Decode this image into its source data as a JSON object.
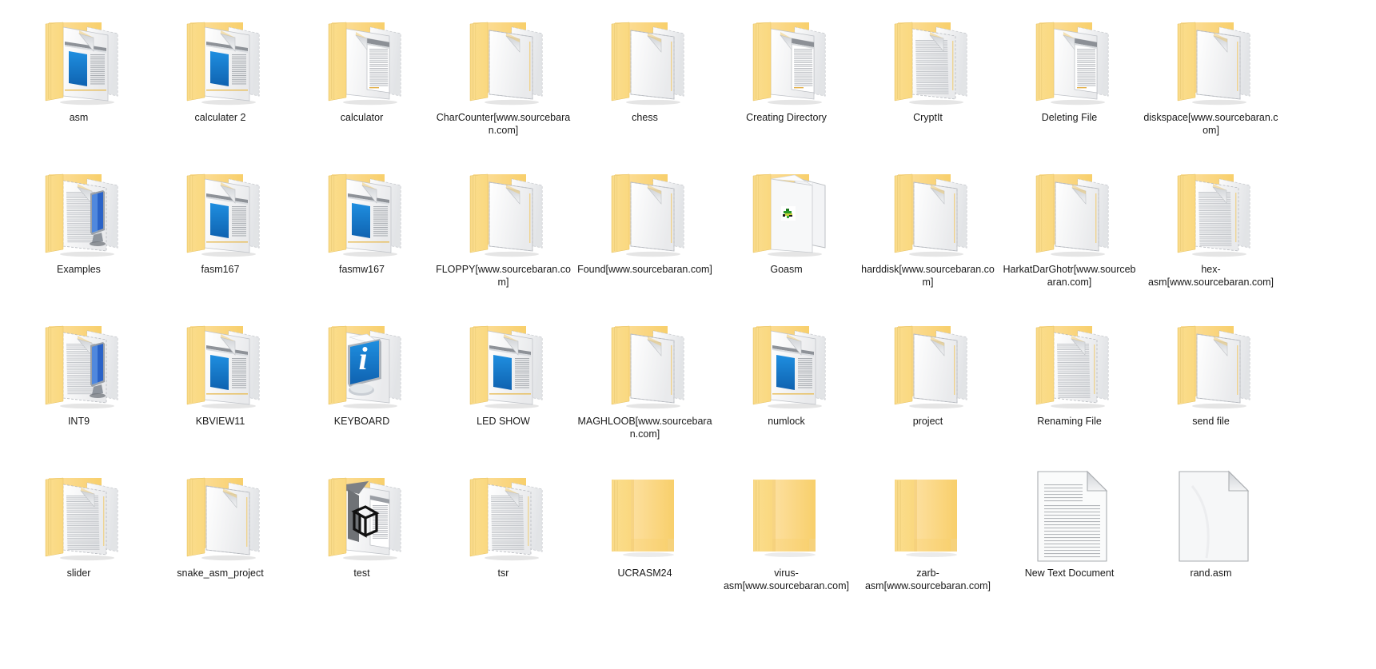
{
  "view": {
    "name": "windows-explorer-icon-view",
    "layout": "extra-large-icons",
    "columns": 9,
    "rows": 4,
    "background_color": "#ffffff",
    "label_color": "#1a1a1a",
    "folder_color": "#fcd978",
    "folder_color_dark": "#f0c95e",
    "paper_color": "#fbfbfb",
    "accent_blue": "#1b7fd4"
  },
  "items": [
    {
      "label": "asm",
      "icon": "folder-open-document-window-icon",
      "type": "folder"
    },
    {
      "label": "calculater 2",
      "icon": "folder-open-document-window-icon",
      "type": "folder"
    },
    {
      "label": "calculator",
      "icon": "folder-open-window-icon",
      "type": "folder"
    },
    {
      "label": "CharCounter[www.sourcebaran.com]",
      "icon": "folder-open-blank-page-icon",
      "type": "folder"
    },
    {
      "label": "chess",
      "icon": "folder-open-blank-page-icon",
      "type": "folder"
    },
    {
      "label": "Creating Directory",
      "icon": "folder-open-window-icon",
      "type": "folder"
    },
    {
      "label": "CryptIt",
      "icon": "folder-open-lined-page-icon",
      "type": "folder"
    },
    {
      "label": "Deleting File",
      "icon": "folder-open-window-icon",
      "type": "folder"
    },
    {
      "label": "diskspace[www.sourcebaran.com]",
      "icon": "folder-open-blank-page-icon",
      "type": "folder"
    },
    {
      "label": "Examples",
      "icon": "folder-open-monitor-icon",
      "type": "folder"
    },
    {
      "label": "fasm167",
      "icon": "folder-open-document-window-icon",
      "type": "folder"
    },
    {
      "label": "fasmw167",
      "icon": "folder-open-document-window-icon",
      "type": "folder"
    },
    {
      "label": "FLOPPY[www.sourcebaran.com]",
      "icon": "folder-open-blank-page-icon",
      "type": "folder"
    },
    {
      "label": "Found[www.sourcebaran.com]",
      "icon": "folder-open-blank-page-icon",
      "type": "folder"
    },
    {
      "label": "Goasm",
      "icon": "folder-open-sprite-icon",
      "type": "folder"
    },
    {
      "label": "harddisk[www.sourcebaran.com]",
      "icon": "folder-open-blank-page-icon",
      "type": "folder"
    },
    {
      "label": "HarkatDarGhotr[www.sourcebaran.com]",
      "icon": "folder-open-blank-page-icon",
      "type": "folder"
    },
    {
      "label": "hex-asm[www.sourcebaran.com]",
      "icon": "folder-open-lined-page-icon",
      "type": "folder"
    },
    {
      "label": "INT9",
      "icon": "folder-open-monitor-icon",
      "type": "folder"
    },
    {
      "label": "KBVIEW11",
      "icon": "folder-open-document-window-icon",
      "type": "folder"
    },
    {
      "label": "KEYBOARD",
      "icon": "folder-open-info-monitor-icon",
      "type": "folder"
    },
    {
      "label": "LED SHOW",
      "icon": "folder-open-document-window-icon",
      "type": "folder"
    },
    {
      "label": "MAGHLOOB[www.sourcebaran.com]",
      "icon": "folder-open-blank-page-icon",
      "type": "folder"
    },
    {
      "label": "numlock",
      "icon": "folder-open-document-window-icon",
      "type": "folder"
    },
    {
      "label": "project",
      "icon": "folder-open-blank-page-icon",
      "type": "folder"
    },
    {
      "label": "Renaming File",
      "icon": "folder-open-lined-page-icon",
      "type": "folder"
    },
    {
      "label": "send file",
      "icon": "folder-open-blank-page-icon",
      "type": "folder"
    },
    {
      "label": "slider",
      "icon": "folder-open-lined-page-icon",
      "type": "folder"
    },
    {
      "label": "snake_asm_project",
      "icon": "folder-open-blank-page-icon",
      "type": "folder"
    },
    {
      "label": "test",
      "icon": "folder-open-3d-object-icon",
      "type": "folder"
    },
    {
      "label": "tsr",
      "icon": "folder-open-lined-page-icon",
      "type": "folder"
    },
    {
      "label": "UCRASM24",
      "icon": "folder-closed-empty-icon",
      "type": "folder"
    },
    {
      "label": "virus-asm[www.sourcebaran.com]",
      "icon": "folder-closed-empty-icon",
      "type": "folder"
    },
    {
      "label": "zarb-asm[www.sourcebaran.com]",
      "icon": "folder-closed-empty-icon",
      "type": "folder"
    },
    {
      "label": "New Text Document",
      "icon": "text-document-icon",
      "type": "file"
    },
    {
      "label": "rand.asm",
      "icon": "blank-document-icon",
      "type": "file"
    }
  ]
}
